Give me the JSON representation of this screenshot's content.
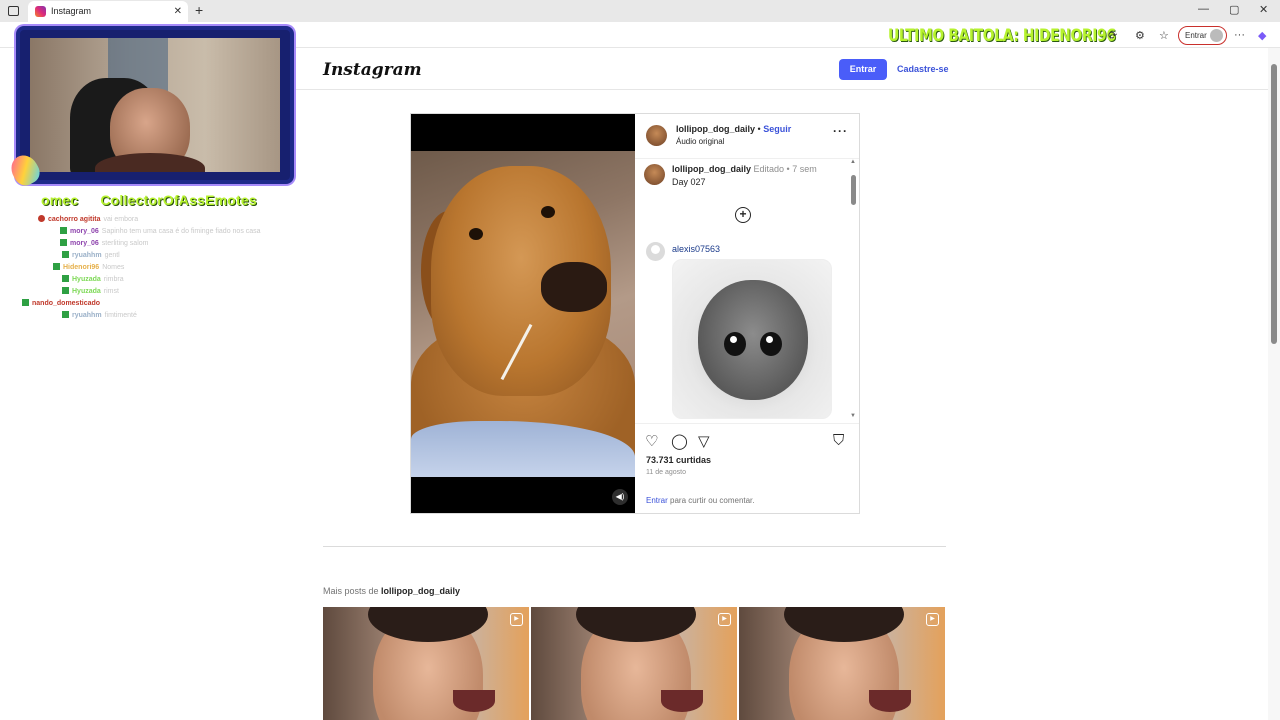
{
  "browser": {
    "tab_title": "Instagram",
    "tab_close": "✕",
    "new_tab": "+",
    "win_minimize": "—",
    "win_maximize": "▢",
    "win_close": "✕",
    "overlay_banner": "ULTIMO BAITOLA: HIDENORI96",
    "profile_button": "Entrar",
    "more": "···"
  },
  "instagram": {
    "logo": "Instagram",
    "login_button": "Entrar",
    "signup_link": "Cadastre-se"
  },
  "post": {
    "author": "lollipop_dog_daily",
    "separator": "•",
    "follow": "Seguir",
    "audio": "Áudio original",
    "more": "···",
    "caption_author": "lollipop_dog_daily",
    "caption_meta": "Editado • 7 sem",
    "caption_text": "Day 027",
    "comment_user": "alexis07563",
    "likes": "73.731 curtidas",
    "date": "11 de agosto",
    "login_link": "Entrar",
    "login_suffix": " para curtir ou comentar."
  },
  "more_posts": {
    "prefix": "Mais posts de ",
    "author": "lollipop_dog_daily"
  },
  "stream_overlay": {
    "emote_left": "omec",
    "emote_right": "CollectorOfAssEmotes",
    "chat": [
      {
        "nick": "cachorro agitita",
        "msg": "vai embora",
        "color": "#c0392b",
        "badge": "red",
        "indent": 28
      },
      {
        "nick": "mory_06",
        "msg": "Sapinho tem uma casa é do fiminge fiado nos casa",
        "color": "#8e44ad",
        "badge": "green",
        "indent": 50
      },
      {
        "nick": "mory_06",
        "msg": "sterliting salom",
        "color": "#8e44ad",
        "badge": "green",
        "indent": 50
      },
      {
        "nick": "ryuahhm",
        "msg": "gentl",
        "color": "#9ab0c8",
        "badge": "green",
        "indent": 52
      },
      {
        "nick": "Hidenori96",
        "msg": "Nomes",
        "color": "#e6b04a",
        "badge": "green",
        "indent": 43
      },
      {
        "nick": "Hyuzada",
        "msg": "rimbra",
        "color": "#7ed957",
        "badge": "green",
        "indent": 52
      },
      {
        "nick": "Hyuzada",
        "msg": "rimst",
        "color": "#7ed957",
        "badge": "green",
        "indent": 52
      },
      {
        "nick": "nando_domesticado",
        "msg": "",
        "color": "#c0392b",
        "badge": "green",
        "indent": 12
      },
      {
        "nick": "ryuahhm",
        "msg": "fimtimenté",
        "color": "#9ab0c8",
        "badge": "green",
        "indent": 52
      }
    ]
  },
  "colors": {
    "ig_blue": "#4a5df9",
    "link_blue": "#3b52d9",
    "overlay_green": "#b6f22e"
  }
}
